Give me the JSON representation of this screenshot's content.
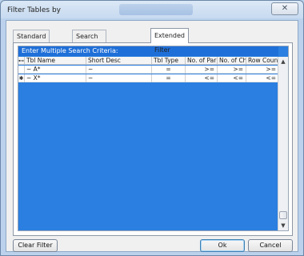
{
  "window": {
    "title": "Filter Tables by",
    "close_glyph": "✕"
  },
  "tabs": [
    {
      "label": "Standard Filter",
      "active": false
    },
    {
      "label": "Search for Field Patterns",
      "active": false
    },
    {
      "label": "Extended Filter",
      "active": true
    }
  ],
  "grid": {
    "caption": "Enter Multiple Search Criteria:",
    "columns": [
      "Tbl Name",
      "Short Desc",
      "Tbl Type",
      "No. of Par",
      "No. of Chi",
      "Row Count"
    ],
    "header_selector_glyph": "⊷",
    "rows": [
      {
        "selector": "",
        "cells": [
          "~  A*",
          "~",
          "=",
          ">=",
          ">=",
          ">="
        ]
      },
      {
        "selector": "✱",
        "cells": [
          "~  X*",
          "~",
          "=",
          "<=",
          "<=",
          "<="
        ]
      }
    ],
    "scroll_up_glyph": "▲",
    "scroll_down_glyph": "▼"
  },
  "buttons": {
    "clear_filter": "Clear Filter",
    "ok": "Ok",
    "cancel": "Cancel"
  }
}
